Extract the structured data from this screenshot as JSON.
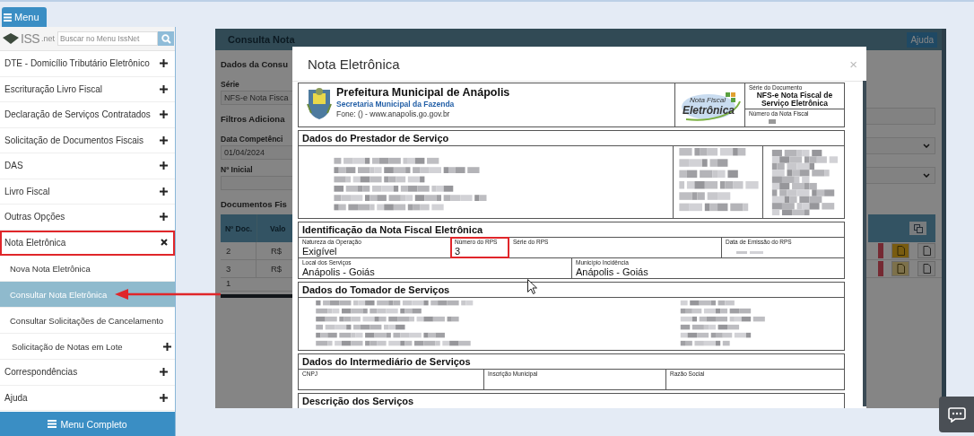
{
  "menu_button": {
    "label": "Menu"
  },
  "sidebar": {
    "logo": {
      "main": "ISS",
      "suffix": ".net"
    },
    "search": {
      "placeholder": "Buscar no Menu IssNet"
    },
    "items": [
      {
        "label": "DTE - Domicílio Tributário Eletrônico",
        "expanded": false,
        "highlighted": false
      },
      {
        "label": "Escrituração Livro Fiscal",
        "expanded": false,
        "highlighted": false
      },
      {
        "label": "Declaração de Serviços Contratados",
        "expanded": false,
        "highlighted": false
      },
      {
        "label": "Solicitação de Documentos Fiscais",
        "expanded": false,
        "highlighted": false
      },
      {
        "label": "DAS",
        "expanded": false,
        "highlighted": false
      },
      {
        "label": "Livro Fiscal",
        "expanded": false,
        "highlighted": false
      },
      {
        "label": "Outras Opções",
        "expanded": false,
        "highlighted": false
      },
      {
        "label": "Nota Eletrônica",
        "expanded": true,
        "highlighted": true,
        "children": [
          {
            "kind": "link",
            "label": "Nova Nota Eletrônica",
            "selected": false,
            "pointed": false
          },
          {
            "kind": "link",
            "label": "Consultar Nota Eletrônica",
            "selected": true,
            "pointed": true
          },
          {
            "kind": "link",
            "label": "Consultar Solicitações de Cancelamento",
            "selected": false,
            "pointed": false
          },
          {
            "kind": "group",
            "label": "Solicitação de Notas em Lote",
            "selected": false,
            "pointed": false,
            "expanded": false
          }
        ]
      },
      {
        "label": "Correspondências",
        "expanded": false,
        "highlighted": false
      },
      {
        "label": "Ajuda",
        "expanded": false,
        "highlighted": false
      }
    ],
    "footer_button": {
      "label": "Menu Completo"
    }
  },
  "background_page": {
    "title": "Consulta Nota",
    "help_button": "Ajuda",
    "left_fields": [
      {
        "kind": "heading",
        "text": "Dados da Consu"
      },
      {
        "kind": "label",
        "text": "Série"
      },
      {
        "kind": "input",
        "text": "NFS-e Nota Fisca"
      },
      {
        "kind": "heading",
        "text": "Filtros Adiciona"
      },
      {
        "kind": "label",
        "text": "Data Competênci"
      },
      {
        "kind": "input",
        "text": "01/04/2024"
      },
      {
        "kind": "label",
        "text": "Nº Inicial"
      },
      {
        "kind": "input"
      },
      {
        "kind": "heading",
        "text": "Documentos Fis"
      }
    ],
    "right_fields": [
      {
        "kind": "input"
      },
      {
        "kind": "select"
      },
      {
        "kind": "select"
      }
    ],
    "table": {
      "columns": [
        "Nº Doc.",
        "Valo"
      ],
      "rows": [
        {
          "cells": [
            "2",
            "R$"
          ],
          "xml_enabled": true
        },
        {
          "cells": [
            "3",
            "R$"
          ],
          "xml_enabled": false
        }
      ],
      "pager": "1"
    }
  },
  "modal": {
    "title": "Nota Eletrônica",
    "close": "×",
    "document": {
      "header": {
        "org": "Prefeitura Municipal de Anápolis",
        "dept": "Secretaria Municipal da Fazenda",
        "contact": "Fone: () - www.anapolis.go.gov.br",
        "logo": {
          "line1": "Nota Fiscal",
          "line2": "Eletrônica"
        },
        "serie_label": "Série do Documento",
        "serie_value": "NFS-e Nota Fiscal de Serviço Eletrônica",
        "numero_label": "Número da Nota Fiscal"
      },
      "sections": [
        {
          "kind": "prestador",
          "title": "Dados do Prestador de Serviço"
        },
        {
          "kind": "fields",
          "title": "Identificação da Nota Fiscal Eletrônica",
          "rows": [
            [
              {
                "kind": "text",
                "label": "Natureza da Operação",
                "value": "Exigível",
                "highlighted": false
              },
              {
                "kind": "text",
                "label": "Número do RPS",
                "value": "3",
                "highlighted": true
              },
              {
                "kind": "text",
                "label": "Série do RPS",
                "highlighted": false
              },
              {
                "kind": "blurred",
                "label": "Data de Emissão do RPS",
                "highlighted": false
              }
            ],
            [
              {
                "kind": "text",
                "label": "Local dos Serviços",
                "value": "Anápolis - Goiás",
                "highlighted": false
              },
              {
                "kind": "text",
                "label": "Município Incidência",
                "value": "Anápolis - Goiás",
                "highlighted": false
              }
            ]
          ]
        },
        {
          "kind": "tomador",
          "title": "Dados do Tomador de Serviços"
        },
        {
          "kind": "fields",
          "title": "Dados do Intermediário de Serviços",
          "rows": [
            [
              {
                "kind": "text",
                "label": "CNPJ",
                "highlighted": false
              },
              {
                "kind": "text",
                "label": "Inscrição Municipal",
                "highlighted": false
              },
              {
                "kind": "text",
                "label": "Razão Social",
                "highlighted": false
              }
            ]
          ]
        },
        {
          "kind": "title_only",
          "title": "Descrição dos Serviços"
        }
      ]
    }
  }
}
